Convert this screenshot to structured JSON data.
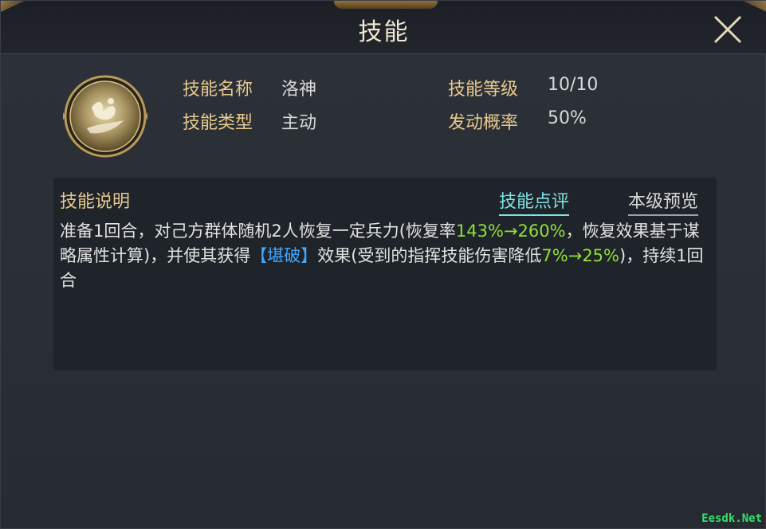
{
  "window": {
    "title": "技能"
  },
  "skill": {
    "name_label": "技能名称",
    "name_value": "洛神",
    "level_label": "技能等级",
    "level_value": "10/10",
    "type_label": "技能类型",
    "type_value": "主动",
    "rate_label": "发动概率",
    "rate_value": "50%"
  },
  "description": {
    "title": "技能说明",
    "tabs": {
      "review": "技能点评",
      "preview": "本级预览"
    },
    "segments": [
      {
        "text": "准备1回合，对己方群体随机2人恢复一定兵力(恢复率",
        "style": "normal"
      },
      {
        "text": "143%→260%",
        "style": "green"
      },
      {
        "text": "，恢复效果基于谋略属性计算)，并使其获得",
        "style": "normal"
      },
      {
        "text": "【堪破】",
        "style": "blue"
      },
      {
        "text": "效果(受到的指挥技能伤害降低",
        "style": "normal"
      },
      {
        "text": "7%→25%",
        "style": "green"
      },
      {
        "text": ")，持续1回合",
        "style": "normal"
      }
    ]
  },
  "icons": {
    "close": "close-icon",
    "skill": "skill-emblem-icon"
  },
  "colors": {
    "label_gold": "#e7c98c",
    "highlight_green": "#8fe03a",
    "highlight_blue": "#3fa8ff",
    "tab_active": "#7fe0e0"
  },
  "watermark": "Eesdk.Net"
}
